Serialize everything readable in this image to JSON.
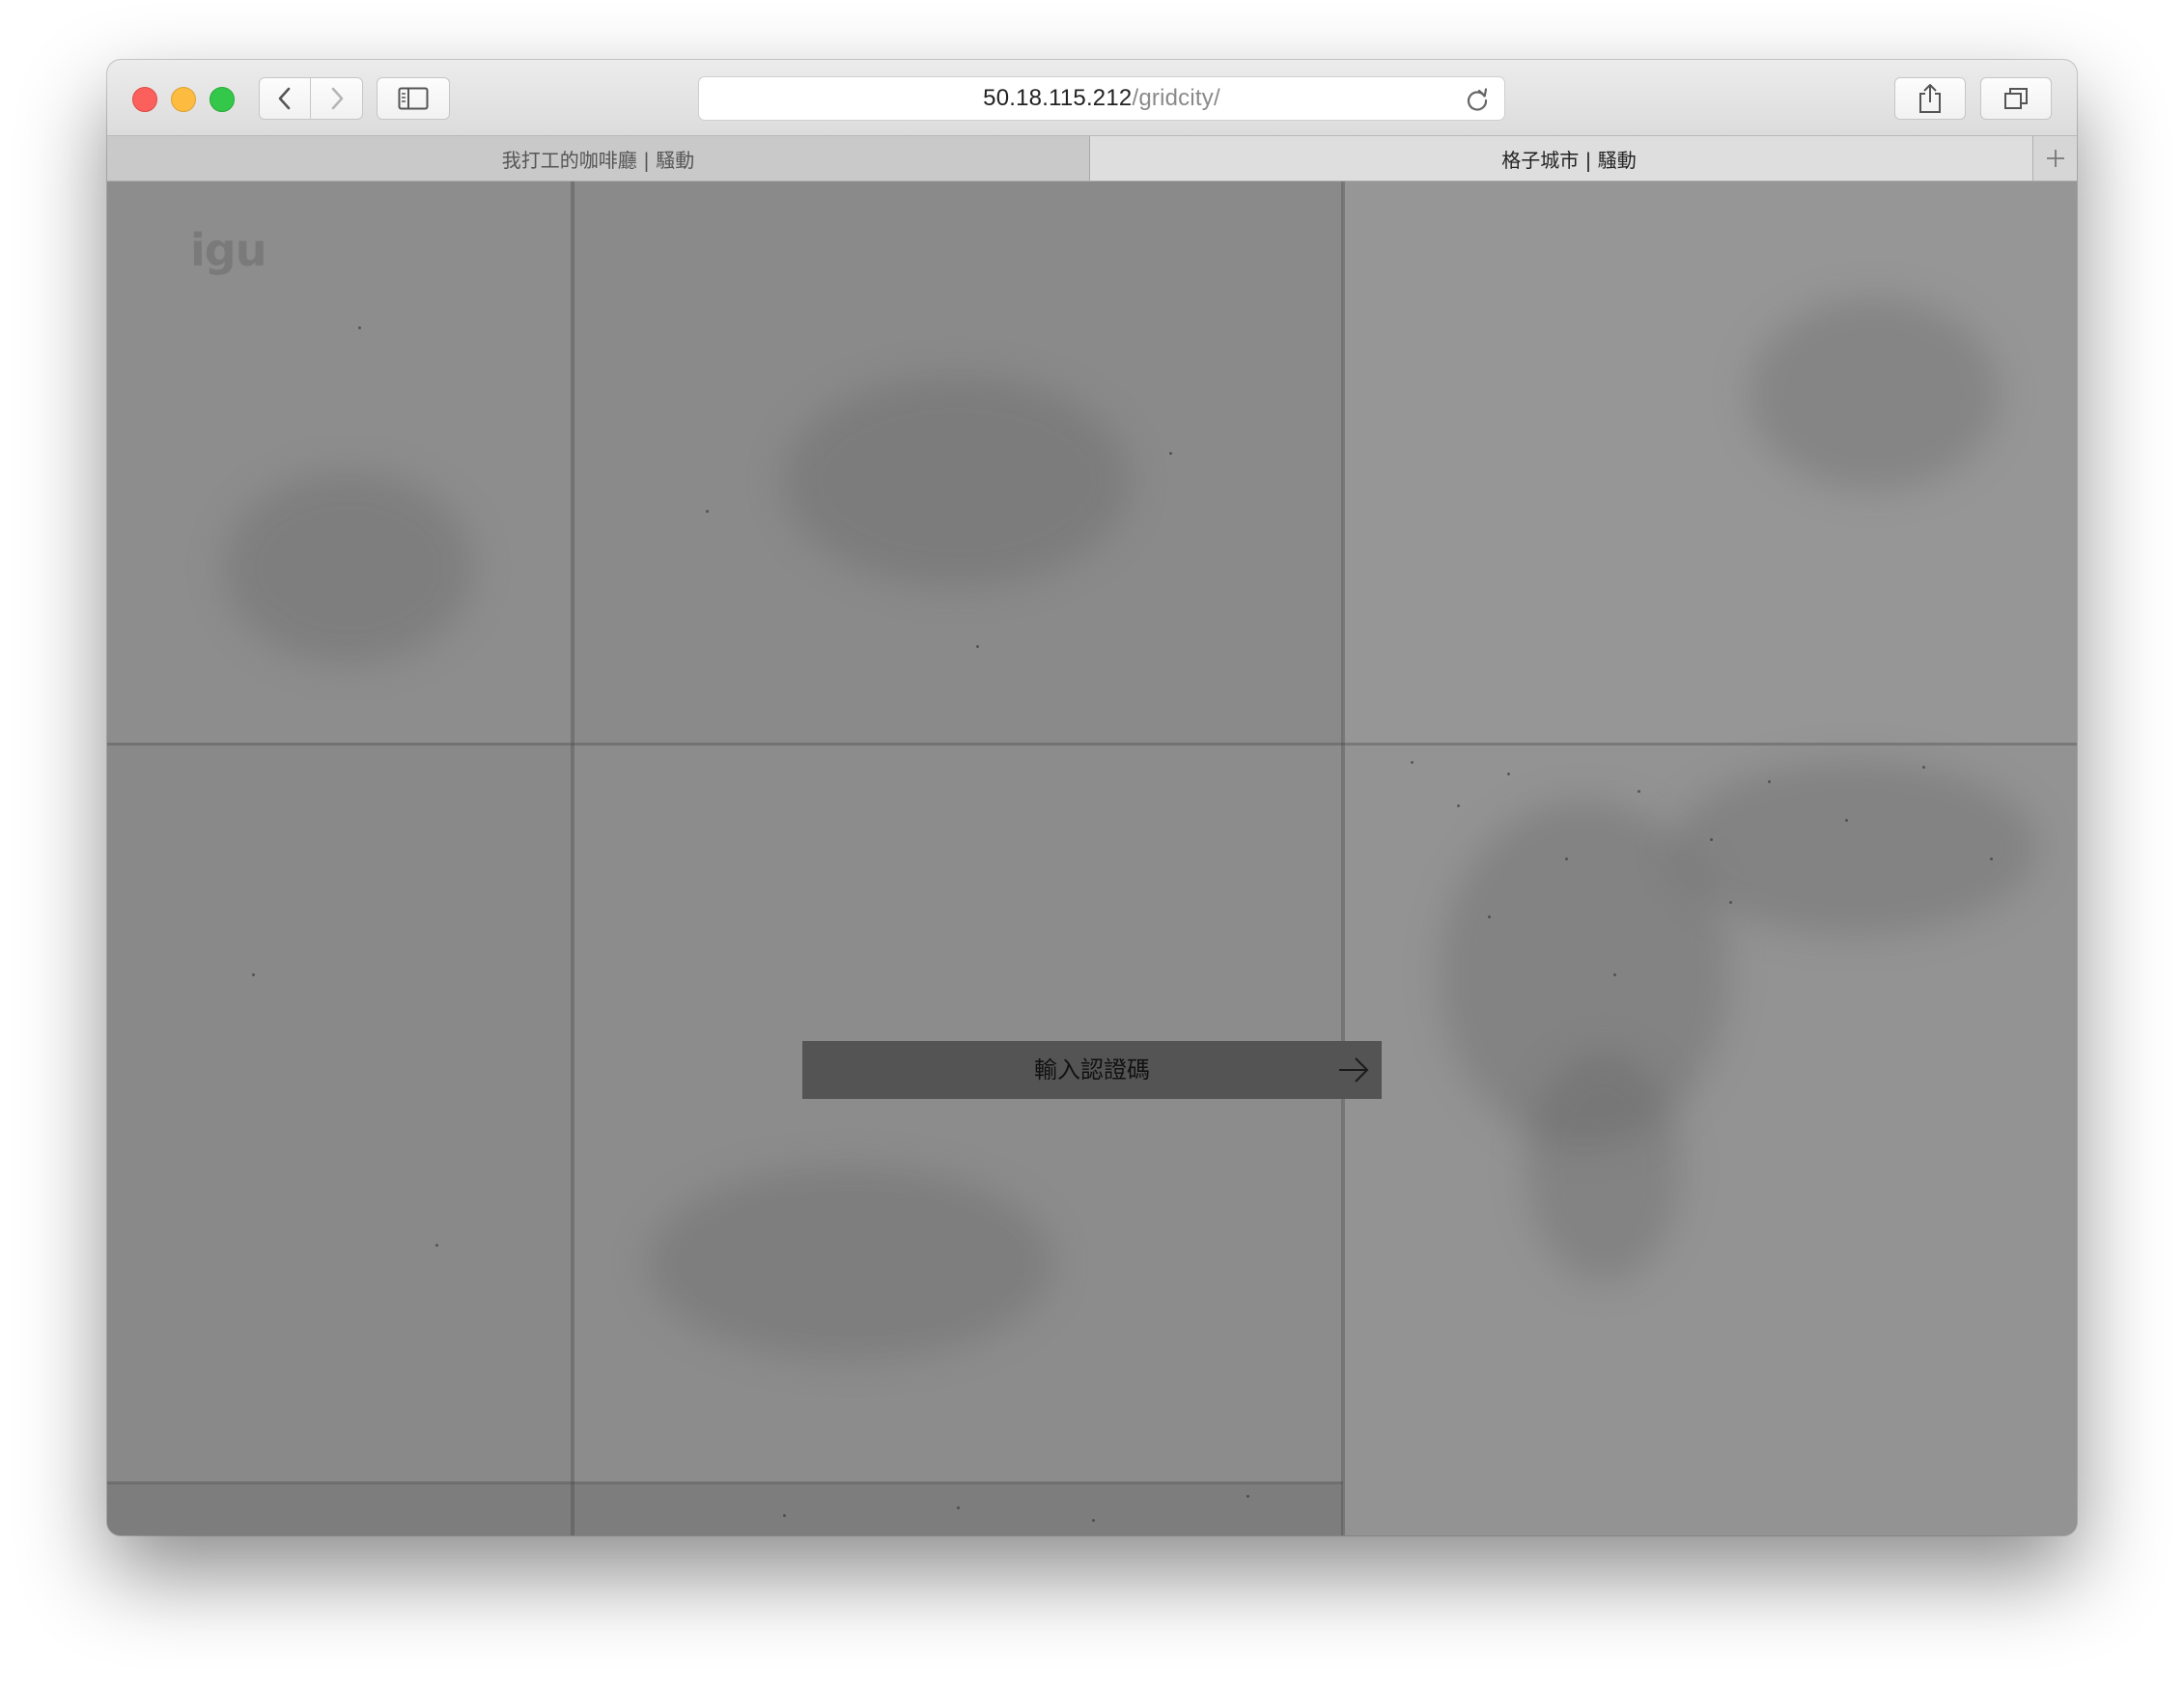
{
  "browser": {
    "url_host": "50.18.115.212",
    "url_path": "/gridcity/",
    "tabs": [
      {
        "title": "我打工的咖啡廳 | 騷動"
      },
      {
        "title": "格子城市 | 騷動"
      }
    ],
    "icons": {
      "back": "chevron-left-icon",
      "forward": "chevron-right-icon",
      "sidebar": "sidebar-icon",
      "reload": "reload-icon",
      "share": "share-icon",
      "tabs": "tabs-overview-icon",
      "new_tab": "plus-icon"
    }
  },
  "page": {
    "logo": "igu",
    "auth_placeholder": "輸入認證碼",
    "submit_icon": "arrow-right-icon"
  }
}
